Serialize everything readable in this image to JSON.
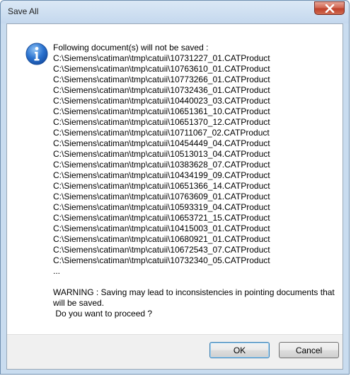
{
  "window": {
    "title": "Save All",
    "close_icon": "close-icon"
  },
  "message": {
    "icon": "info-icon",
    "heading": "Following document(s) will not be saved :",
    "documents": [
      "C:\\Siemens\\catiman\\tmp\\catuii\\10731227_01.CATProduct",
      "C:\\Siemens\\catiman\\tmp\\catuii\\10763610_01.CATProduct",
      "C:\\Siemens\\catiman\\tmp\\catuii\\10773266_01.CATProduct",
      "C:\\Siemens\\catiman\\tmp\\catuii\\10732436_01.CATProduct",
      "C:\\Siemens\\catiman\\tmp\\catuii\\10440023_03.CATProduct",
      "C:\\Siemens\\catiman\\tmp\\catuii\\10651361_10.CATProduct",
      "C:\\Siemens\\catiman\\tmp\\catuii\\10651370_12.CATProduct",
      "C:\\Siemens\\catiman\\tmp\\catuii\\10711067_02.CATProduct",
      "C:\\Siemens\\catiman\\tmp\\catuii\\10454449_04.CATProduct",
      "C:\\Siemens\\catiman\\tmp\\catuii\\10513013_04.CATProduct",
      "C:\\Siemens\\catiman\\tmp\\catuii\\10383628_07.CATProduct",
      "C:\\Siemens\\catiman\\tmp\\catuii\\10434199_09.CATProduct",
      "C:\\Siemens\\catiman\\tmp\\catuii\\10651366_14.CATProduct",
      "C:\\Siemens\\catiman\\tmp\\catuii\\10763609_01.CATProduct",
      "C:\\Siemens\\catiman\\tmp\\catuii\\10593319_04.CATProduct",
      "C:\\Siemens\\catiman\\tmp\\catuii\\10653721_15.CATProduct",
      "C:\\Siemens\\catiman\\tmp\\catuii\\10415003_01.CATProduct",
      "C:\\Siemens\\catiman\\tmp\\catuii\\10680921_01.CATProduct",
      "C:\\Siemens\\catiman\\tmp\\catuii\\10672543_07.CATProduct",
      "C:\\Siemens\\catiman\\tmp\\catuii\\10732340_05.CATProduct"
    ],
    "ellipsis": "...",
    "warning_line1": "WARNING : Saving may lead to inconsistencies in pointing documents that will be saved.",
    "warning_line2": " Do you want to proceed ?"
  },
  "buttons": {
    "ok": "OK",
    "cancel": "Cancel"
  }
}
